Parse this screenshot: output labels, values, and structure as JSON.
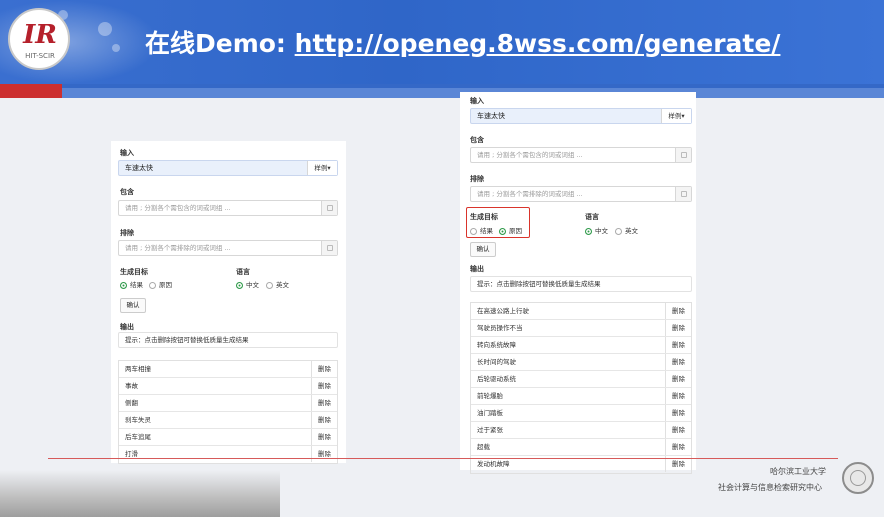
{
  "header": {
    "title_prefix": "在线Demo: ",
    "title_url": "http://openeg.8wss.com/generate/",
    "logo_mark": "IR",
    "logo_sub": "HIT-SCIR"
  },
  "left": {
    "input_label": "输入",
    "input_value": "车速太快",
    "example_button": "样例▾",
    "include_label": "包含",
    "include_placeholder": "请用 ; 分割各个需包含的词或词组 ...",
    "exclude_label": "排除",
    "exclude_placeholder": "请用 ; 分割各个需排除的词或词组 ...",
    "target_label": "生成目标",
    "target_options": [
      "结果",
      "原因"
    ],
    "language_label": "语言",
    "language_options": [
      "中文",
      "英文"
    ],
    "confirm_button": "确认",
    "output_label": "输出",
    "hint": "提示：点击删除按钮可替换低质量生成结果",
    "results": [
      "两车相撞",
      "事故",
      "侧翻",
      "刹车失灵",
      "后车追尾",
      "打滑"
    ],
    "delete_label": "删除"
  },
  "right": {
    "input_label": "输入",
    "input_value": "车速太快",
    "example_button": "样例▾",
    "include_label": "包含",
    "include_placeholder": "请用 ; 分割各个需包含的词或词组 ...",
    "exclude_label": "排除",
    "exclude_placeholder": "请用 ; 分割各个需排除的词或词组 ...",
    "target_label": "生成目标",
    "target_options": [
      "结果",
      "原因"
    ],
    "language_label": "语言",
    "language_options": [
      "中文",
      "英文"
    ],
    "confirm_button": "确认",
    "output_label": "输出",
    "hint": "提示：点击删除按钮可替换低质量生成结果",
    "results": [
      "在高速公路上行驶",
      "驾驶员操作不当",
      "转向系统故障",
      "长时间的驾驶",
      "后轮驱动系统",
      "前轮爆胎",
      "油门踏板",
      "过于紧张",
      "超载",
      "发动机故障"
    ],
    "delete_label": "删除"
  },
  "footer": {
    "university": "哈尔滨工业大学",
    "center": "社会计算与信息检索研究中心"
  },
  "colors": {
    "header_blue": "#2f66c8",
    "accent_red": "#cc2f2f",
    "radio_green": "#2f9a4a"
  }
}
